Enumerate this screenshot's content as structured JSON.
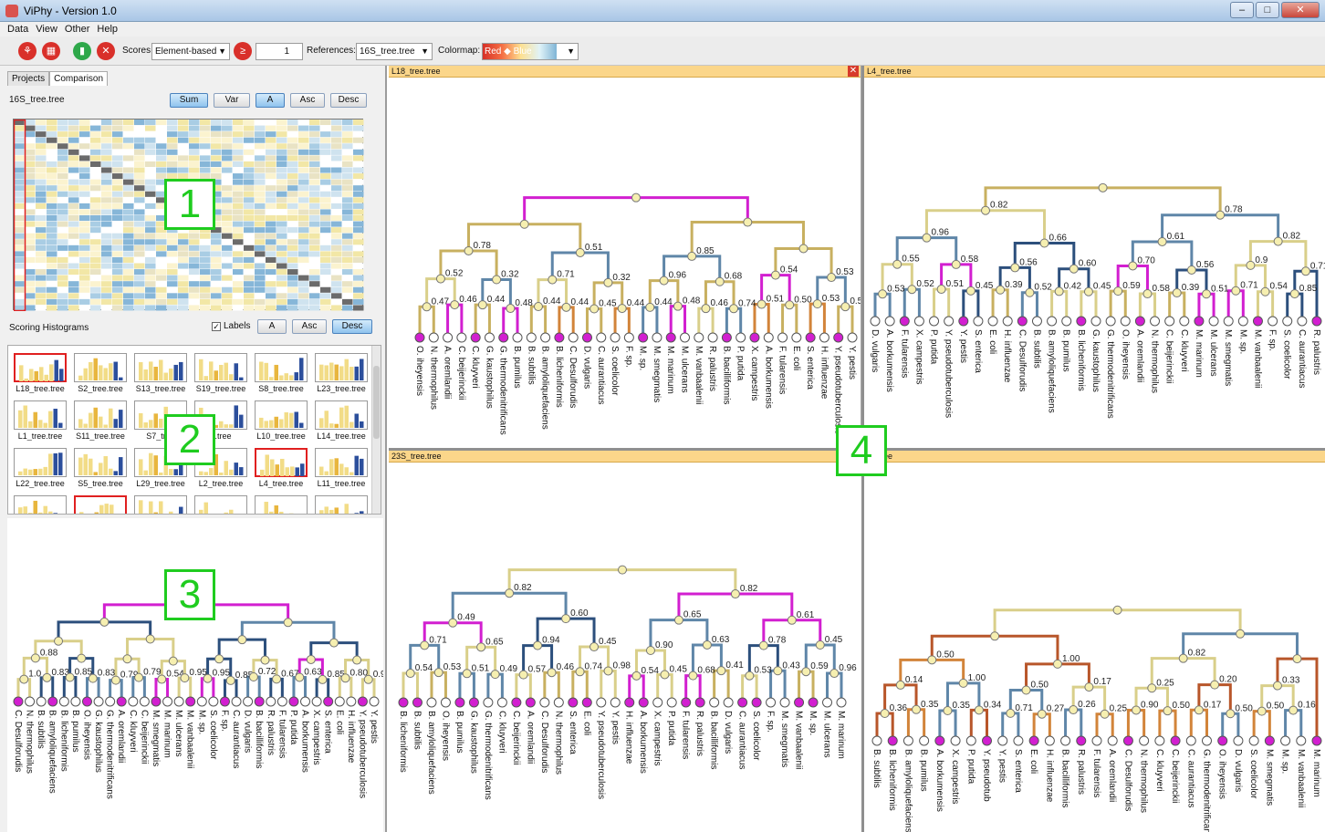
{
  "window": {
    "title": "ViPhy - Version 1.0",
    "min": "–",
    "max": "□",
    "close": "✕"
  },
  "menu": [
    "Data",
    "View",
    "Other",
    "Help"
  ],
  "toolbar": {
    "scores_label": "Scores:",
    "scores_value": "Element-based",
    "step_value": "1",
    "references_label": "References:",
    "references_value": "16S_tree.tree",
    "colormap_label": "Colormap:",
    "colormap_value": "Red ◆ Blue"
  },
  "comparison": {
    "tabs": [
      "Projects",
      "Comparison"
    ],
    "reference_name": "16S_tree.tree",
    "buttons": [
      "Sum",
      "Var",
      "A",
      "Asc",
      "Desc"
    ]
  },
  "histograms": {
    "title": "Scoring Histograms",
    "labels_checkbox": "Labels",
    "buttons": [
      "A",
      "Asc",
      "Desc"
    ],
    "rows": [
      [
        "L18_tree.tree",
        "S2_tree.tree",
        "S13_tree.tree",
        "S19_tree.tree",
        "S8_tree.tree",
        "L23_tree.tree"
      ],
      [
        "L1_tree.tree",
        "S11_tree.tree",
        "S7_tree",
        "e.tree",
        "L10_tree.tree",
        "L14_tree.tree"
      ],
      [
        "L22_tree.tree",
        "S5_tree.tree",
        "L29_tree.tree",
        "L2_tree.tree",
        "L4_tree.tree",
        "L11_tree.tree"
      ]
    ]
  },
  "markers": [
    "1",
    "2",
    "3",
    "4"
  ],
  "trees": {
    "tl_title": "L18_tree.tree",
    "tr_title": "L4_tree.tree",
    "bl_title": "23S_tree.tree",
    "br_title": "ee.tree",
    "tl_close": "✕"
  },
  "tree_tl": {
    "values": [
      "0.47",
      "0.46",
      "0.44",
      "0.48",
      "0.44",
      "0.44",
      "0.45",
      "0.44",
      "0.44",
      "0.48",
      "0.46",
      "0.74",
      "0.51",
      "0.50",
      "0.53",
      "0.50",
      "0.52",
      "0.32",
      "0.71",
      "0.32",
      "0.96",
      "0.68",
      "0.54",
      "0.53",
      "0.78",
      "0.51",
      "0.85"
    ],
    "leaves": [
      "O. iheyensis",
      "N. thermophilus",
      "A. oremlandii",
      "C. beijerinckii",
      "C. kluyveri",
      "G. kaustophilus",
      "G. thermodenitrificans",
      "B. pumilus",
      "B. subtilis",
      "B. amyloliquefaciens",
      "B. licheniformis",
      "C. Desulforudis",
      "D. vulgaris",
      "C. aurantiacus",
      "S. coelicolor",
      "F. sp.",
      "M. sp.",
      "M. smegmatis",
      "M. marinum",
      "M. ulcerans",
      "M. vanbaalenii",
      "R. palustris",
      "B. bacilliformis",
      "P. putida",
      "X. campestris",
      "A. borkumensis",
      "F. tularensis",
      "E. coli",
      "S. enterica",
      "H. influenzae",
      "Y. pseudotuberculosis",
      "Y. pestis"
    ]
  },
  "tree_tr": {
    "values": [
      "0.53",
      "0.52",
      "0.51",
      "0.45",
      "0.39",
      "0.52",
      "0.42",
      "0.45",
      "0.59",
      "0.58",
      "0.39",
      "0.51",
      "0.71",
      "0.54",
      "0.85",
      "0.55",
      "0.58",
      "0.56",
      "0.60",
      "0.70",
      "0.56",
      "0.9",
      "0.71",
      "0.96",
      "0.66",
      "0.61",
      "0.82",
      "0.82",
      "0.78"
    ],
    "leaves": [
      "D. vulgaris",
      "A. borkumensis",
      "F. tularensis",
      "X. campestris",
      "P. putida",
      "Y. pseudotuberculosis",
      "Y. pestis",
      "S. enterica",
      "E. coli",
      "H. influenzae",
      "C. Desulforudis",
      "B. subtilis",
      "B. amyloliquefaciens",
      "B. pumilus",
      "B. licheniformis",
      "G. kaustophilus",
      "G. thermodenitrificans",
      "O. iheyensis",
      "A. oremlandii",
      "N. thermophilus",
      "C. beijerinckii",
      "C. kluyveri",
      "M. marinum",
      "M. ulcerans",
      "M. smegmatis",
      "M. sp.",
      "M. vanbaalenii",
      "F. sp.",
      "S. coelicolor",
      "C. aurantiacus",
      "R. palustris"
    ]
  },
  "tree_bl": {
    "values": [
      "0.54",
      "0.53",
      "0.51",
      "0.49",
      "0.57",
      "0.46",
      "0.74",
      "0.98",
      "0.54",
      "0.45",
      "0.68",
      "0.41",
      "0.53",
      "0.43",
      "0.59",
      "0.96",
      "0.71",
      "0.65",
      "0.94",
      "0.45",
      "0.90",
      "0.63",
      "0.78",
      "0.45",
      "0.49",
      "0.60",
      "0.65",
      "0.61",
      "0.82",
      "0.82"
    ],
    "leaves": [
      "B. licheniformis",
      "B. subtilis",
      "B. amyloliquefaciens",
      "O. iheyensis",
      "B. pumilus",
      "G. kaustophilus",
      "G. thermodenitrificans",
      "C. kluyveri",
      "C. beijerinckii",
      "A. oremlandii",
      "C. Desulforudis",
      "N. thermophilus",
      "S. enterica",
      "E. coli",
      "Y. pseudotuberculosis",
      "Y. pestis",
      "H. influenzae",
      "A. borkumensis",
      "X. campestris",
      "P. putida",
      "F. tularensis",
      "R. palustris",
      "B. bacilliformis",
      "D. vulgaris",
      "C. aurantiacus",
      "S. coelicolor",
      "F. sp.",
      "M. smegmatis",
      "M. vanbaalenii",
      "M. sp.",
      "M. ulcerans",
      "M. marinum"
    ]
  },
  "tree_br": {
    "values": [
      "0.36",
      "0.35",
      "0.35",
      "0.34",
      "0.71",
      "0.27",
      "0.26",
      "0.25",
      "0.90",
      "0.50",
      "0.17",
      "0.50",
      "0.50",
      "0.16",
      "0.14",
      "1.00",
      "0.50",
      "0.17",
      "0.25",
      "0.20",
      "0.33",
      "0.50",
      "1.00",
      "0.82"
    ],
    "leaves": [
      "B. subtilis",
      "B. licheniformis",
      "B. amyloliquefaciens",
      "B. pumilus",
      "A. borkumensis",
      "X. campestris",
      "P. putida",
      "Y. pseudotub",
      "Y. pestis",
      "S. enterica",
      "E. coli",
      "H. influenzae",
      "B. bacilliformis",
      "R. palustris",
      "F. tularensis",
      "A. oremlandii",
      "C. Desulforudis",
      "N. thermophilus",
      "C. kluyveri",
      "C. beijerinckii",
      "C. aurantiacus",
      "G. thermodenitrificans",
      "O. iheyensis",
      "D. vulgaris",
      "S. coelicolor",
      "M. smegmatis",
      "M. sp.",
      "M. vanbaalenii",
      "M. marinum"
    ]
  },
  "tree_side": {
    "values": [
      "1.0",
      "0.83",
      "0.85",
      "0.83",
      "0.79",
      "0.79",
      "0.54",
      "0.95",
      "0.95",
      "0.85",
      "0.72",
      "0.67",
      "0.63",
      "0.85",
      "0.80",
      "0.97",
      "0.88"
    ],
    "leaves": [
      "C. Desulforudis",
      "N. thermophilus",
      "B. subtilis",
      "B. amyloliquefaciens",
      "B. licheniformis",
      "B. pumilus",
      "O. iheyensis",
      "G. kaustophilus",
      "G. thermodenitrificans",
      "A. oremlandii",
      "C. kluyveri",
      "C. beijerinckii",
      "M. smegmatis",
      "M. marinum",
      "M. ulcerans",
      "M. vanbaalenii",
      "M. sp.",
      "S. coelicolor",
      "F. sp.",
      "C. aurantiacus",
      "D. vulgaris",
      "B. bacilliformis",
      "R. palustris",
      "F. tularensis",
      "P. putida",
      "A. borkumensis",
      "X. campestris",
      "S. enterica",
      "E. coli",
      "H. influenzae",
      "Y. pseudotuberculosis",
      "Y. pestis"
    ]
  },
  "colors": {
    "magenta": "#d21fd0",
    "steel": "#5f86a8",
    "navy": "#2c4f7c",
    "olive": "#c8b060",
    "khaki": "#d9cf8a",
    "orange": "#d2843a",
    "rust": "#b8562a",
    "marker_green": "#1fcc1f"
  }
}
